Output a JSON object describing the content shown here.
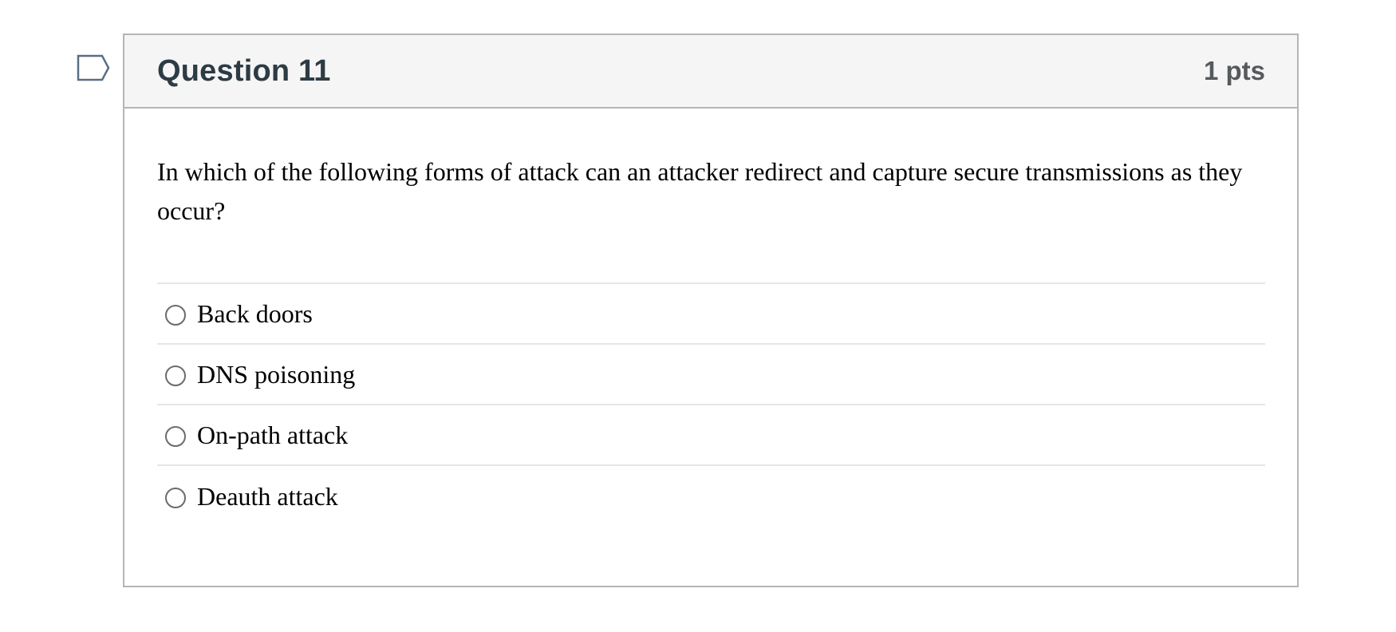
{
  "question": {
    "title": "Question 11",
    "points": "1 pts",
    "text": "In which of the following forms of attack can an attacker redirect and capture secure transmissions as they occur?",
    "answers": [
      {
        "label": "Back doors",
        "selected": false
      },
      {
        "label": "DNS poisoning",
        "selected": false
      },
      {
        "label": "On-path attack",
        "selected": false
      },
      {
        "label": "Deauth attack",
        "selected": false
      }
    ]
  },
  "flag": {
    "icon": "bookmark-flag-icon"
  },
  "colors": {
    "header_bg": "#f5f5f5",
    "border": "#b5b5b5",
    "title": "#2d3b45",
    "points": "#565a5c",
    "flag_stroke": "#5a6e82"
  }
}
